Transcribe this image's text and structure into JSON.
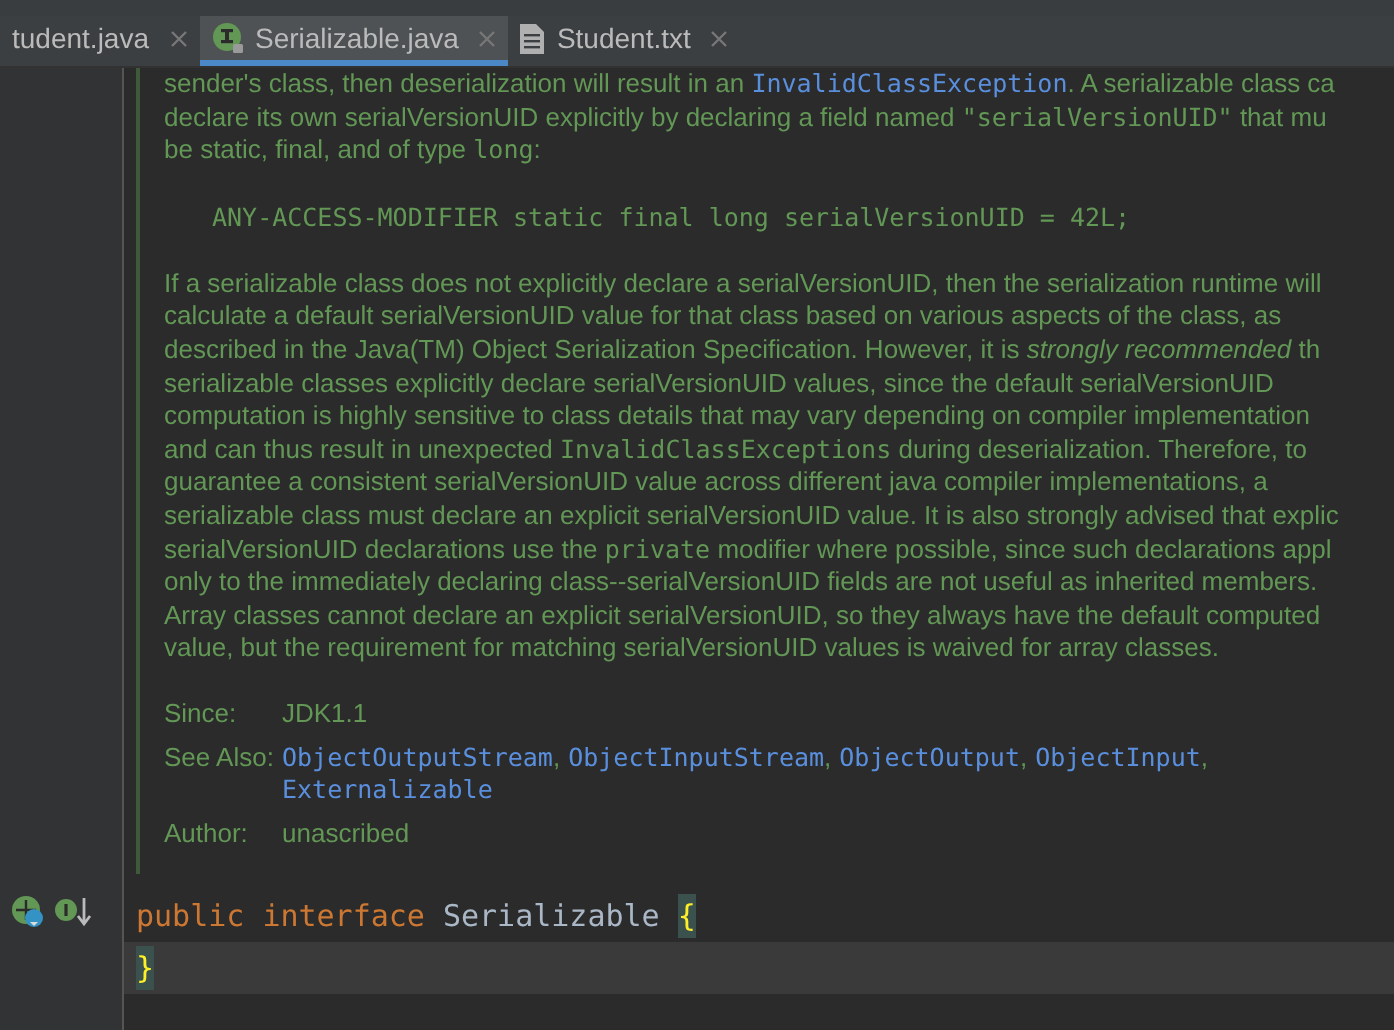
{
  "tabs": [
    {
      "label": "tudent.java",
      "selected": false,
      "kind": "java"
    },
    {
      "label": "Serializable.java",
      "selected": true,
      "kind": "interface"
    },
    {
      "label": "Student.txt",
      "selected": false,
      "kind": "text"
    }
  ],
  "doc": {
    "blocks": [
      {
        "kind": "paragraph",
        "lines": [
          [
            {
              "kind": "text",
              "text": "sender's class, then deserialization will result in an "
            },
            {
              "kind": "link",
              "text": "InvalidClassException"
            },
            {
              "kind": "text",
              "text": ". A serializable class ca"
            }
          ],
          [
            {
              "kind": "text",
              "text": "declare its own serialVersionUID explicitly by declaring a field named "
            },
            {
              "kind": "code",
              "text": "\"serialVersionUID\""
            },
            {
              "kind": "text",
              "text": " that mu"
            }
          ],
          [
            {
              "kind": "text",
              "text": "be static, final, and of type "
            },
            {
              "kind": "code",
              "text": "long"
            },
            {
              "kind": "text",
              "text": ":"
            }
          ]
        ]
      },
      {
        "kind": "code",
        "text": "ANY-ACCESS-MODIFIER static final long serialVersionUID = 42L;"
      },
      {
        "kind": "paragraph",
        "lines": [
          [
            {
              "kind": "text",
              "text": "If a serializable class does not explicitly declare a serialVersionUID, then the serialization runtime will"
            }
          ],
          [
            {
              "kind": "text",
              "text": "calculate a default serialVersionUID value for that class based on various aspects of the class, as"
            }
          ],
          [
            {
              "kind": "text",
              "text": "described in the Java(TM) Object Serialization Specification. However, it is "
            },
            {
              "kind": "em",
              "text": "strongly recommended"
            },
            {
              "kind": "text",
              "text": " th"
            }
          ],
          [
            {
              "kind": "text",
              "text": "serializable classes explicitly declare serialVersionUID values, since the default serialVersionUID"
            }
          ],
          [
            {
              "kind": "text",
              "text": "computation is highly sensitive to class details that may vary depending on compiler implementation"
            }
          ],
          [
            {
              "kind": "text",
              "text": "and can thus result in unexpected "
            },
            {
              "kind": "code",
              "text": "InvalidClassExceptions"
            },
            {
              "kind": "text",
              "text": " during deserialization. Therefore, to"
            }
          ],
          [
            {
              "kind": "text",
              "text": "guarantee a consistent serialVersionUID value across different java compiler implementations, a"
            }
          ],
          [
            {
              "kind": "text",
              "text": "serializable class must declare an explicit serialVersionUID value. It is also strongly advised that explic"
            }
          ],
          [
            {
              "kind": "text",
              "text": "serialVersionUID declarations use the "
            },
            {
              "kind": "code",
              "text": "private"
            },
            {
              "kind": "text",
              "text": " modifier where possible, since such declarations appl"
            }
          ],
          [
            {
              "kind": "text",
              "text": "only to the immediately declaring class--serialVersionUID fields are not useful as inherited members."
            }
          ],
          [
            {
              "kind": "text",
              "text": "Array classes cannot declare an explicit serialVersionUID, so they always have the default computed"
            }
          ],
          [
            {
              "kind": "text",
              "text": "value, but the requirement for matching serialVersionUID values is waived for array classes."
            }
          ]
        ]
      }
    ],
    "tags": [
      {
        "label": "Since:",
        "lines": [
          [
            {
              "kind": "text",
              "text": "JDK1.1"
            }
          ]
        ]
      },
      {
        "label": "See Also:",
        "lines": [
          [
            {
              "kind": "link",
              "text": "ObjectOutputStream",
              "sep": ","
            },
            {
              "kind": "link",
              "text": "ObjectInputStream",
              "sep": ","
            },
            {
              "kind": "link",
              "text": "ObjectOutput",
              "sep": ","
            },
            {
              "kind": "link",
              "text": "ObjectInput",
              "sep": ","
            }
          ],
          [
            {
              "kind": "link",
              "text": "Externalizable"
            }
          ]
        ]
      },
      {
        "label": "Author:",
        "lines": [
          [
            {
              "kind": "text",
              "text": "unascribed"
            }
          ]
        ]
      }
    ]
  },
  "code": {
    "lines": [
      {
        "current": false,
        "tokens": [
          {
            "kind": "keyword",
            "text": "public"
          },
          {
            "kind": "keyword",
            "text": "interface"
          },
          {
            "kind": "name",
            "text": "Serializable"
          },
          {
            "kind": "brace",
            "text": "{",
            "matched": true
          }
        ]
      },
      {
        "current": true,
        "tokens": [
          {
            "kind": "brace",
            "text": "}",
            "matched": true
          }
        ]
      }
    ]
  }
}
